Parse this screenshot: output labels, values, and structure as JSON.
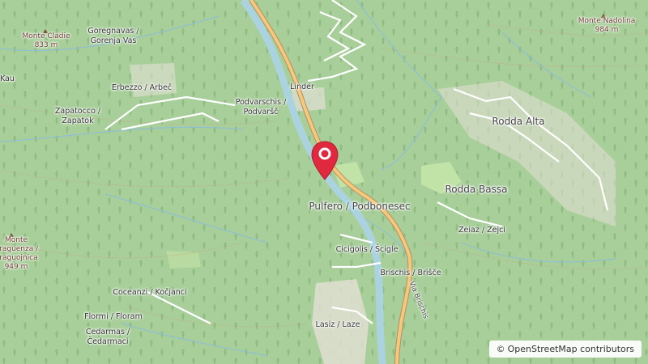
{
  "map": {
    "labels": {
      "monte_cladie_name": "Monte Cladie",
      "monte_cladie_elev": "833 m",
      "goregnavas": "Goregnavas /",
      "gorenja_vas": "Gorenja Vas",
      "kau": "Kau",
      "erbezzo": "Erbezzo / Arbeč",
      "zapatocco": "Zapatocco /",
      "zapatok": "Zapatok",
      "podvarschis": "Podvarschis /",
      "podvarsc": "Podvaršč",
      "linder": "Linder",
      "monte_nadolina_name": "Monte Nadolina",
      "monte_nadolina_elev": "984 m",
      "rodda_alta": "Rodda Alta",
      "rodda_bassa": "Rodda Bassa",
      "pulfero": "Pulfero / Podbonesec",
      "zeiaz": "Zeiaz / Zejci",
      "cicigolis": "Cicigolis / Šcigle",
      "brischis": "Brischis / Brišče",
      "via_brischis": "Via Brischis",
      "monte_craguenza_1": "Monte",
      "monte_craguenza_2": "Craguenza /",
      "monte_craguenza_3": "Kraguojnica",
      "monte_craguenza_elev": "949 m",
      "coceanzi": "Coceanzi / Kočjanci",
      "flormi": "Flormi / Floram",
      "cedarmas": "Cedarmas /",
      "cedarmaci": "Čedarmaci",
      "lasiz": "Lasiz / Laze"
    },
    "attribution": {
      "symbol": "©",
      "text": "OpenStreetMap contributors"
    },
    "colors": {
      "forest": "#a8cf9a",
      "river": "#aad3df",
      "road_main": "#f7c77a",
      "marker": "#e0283f"
    },
    "icons": [
      "location-pin-icon",
      "peak-triangle-icon"
    ]
  }
}
